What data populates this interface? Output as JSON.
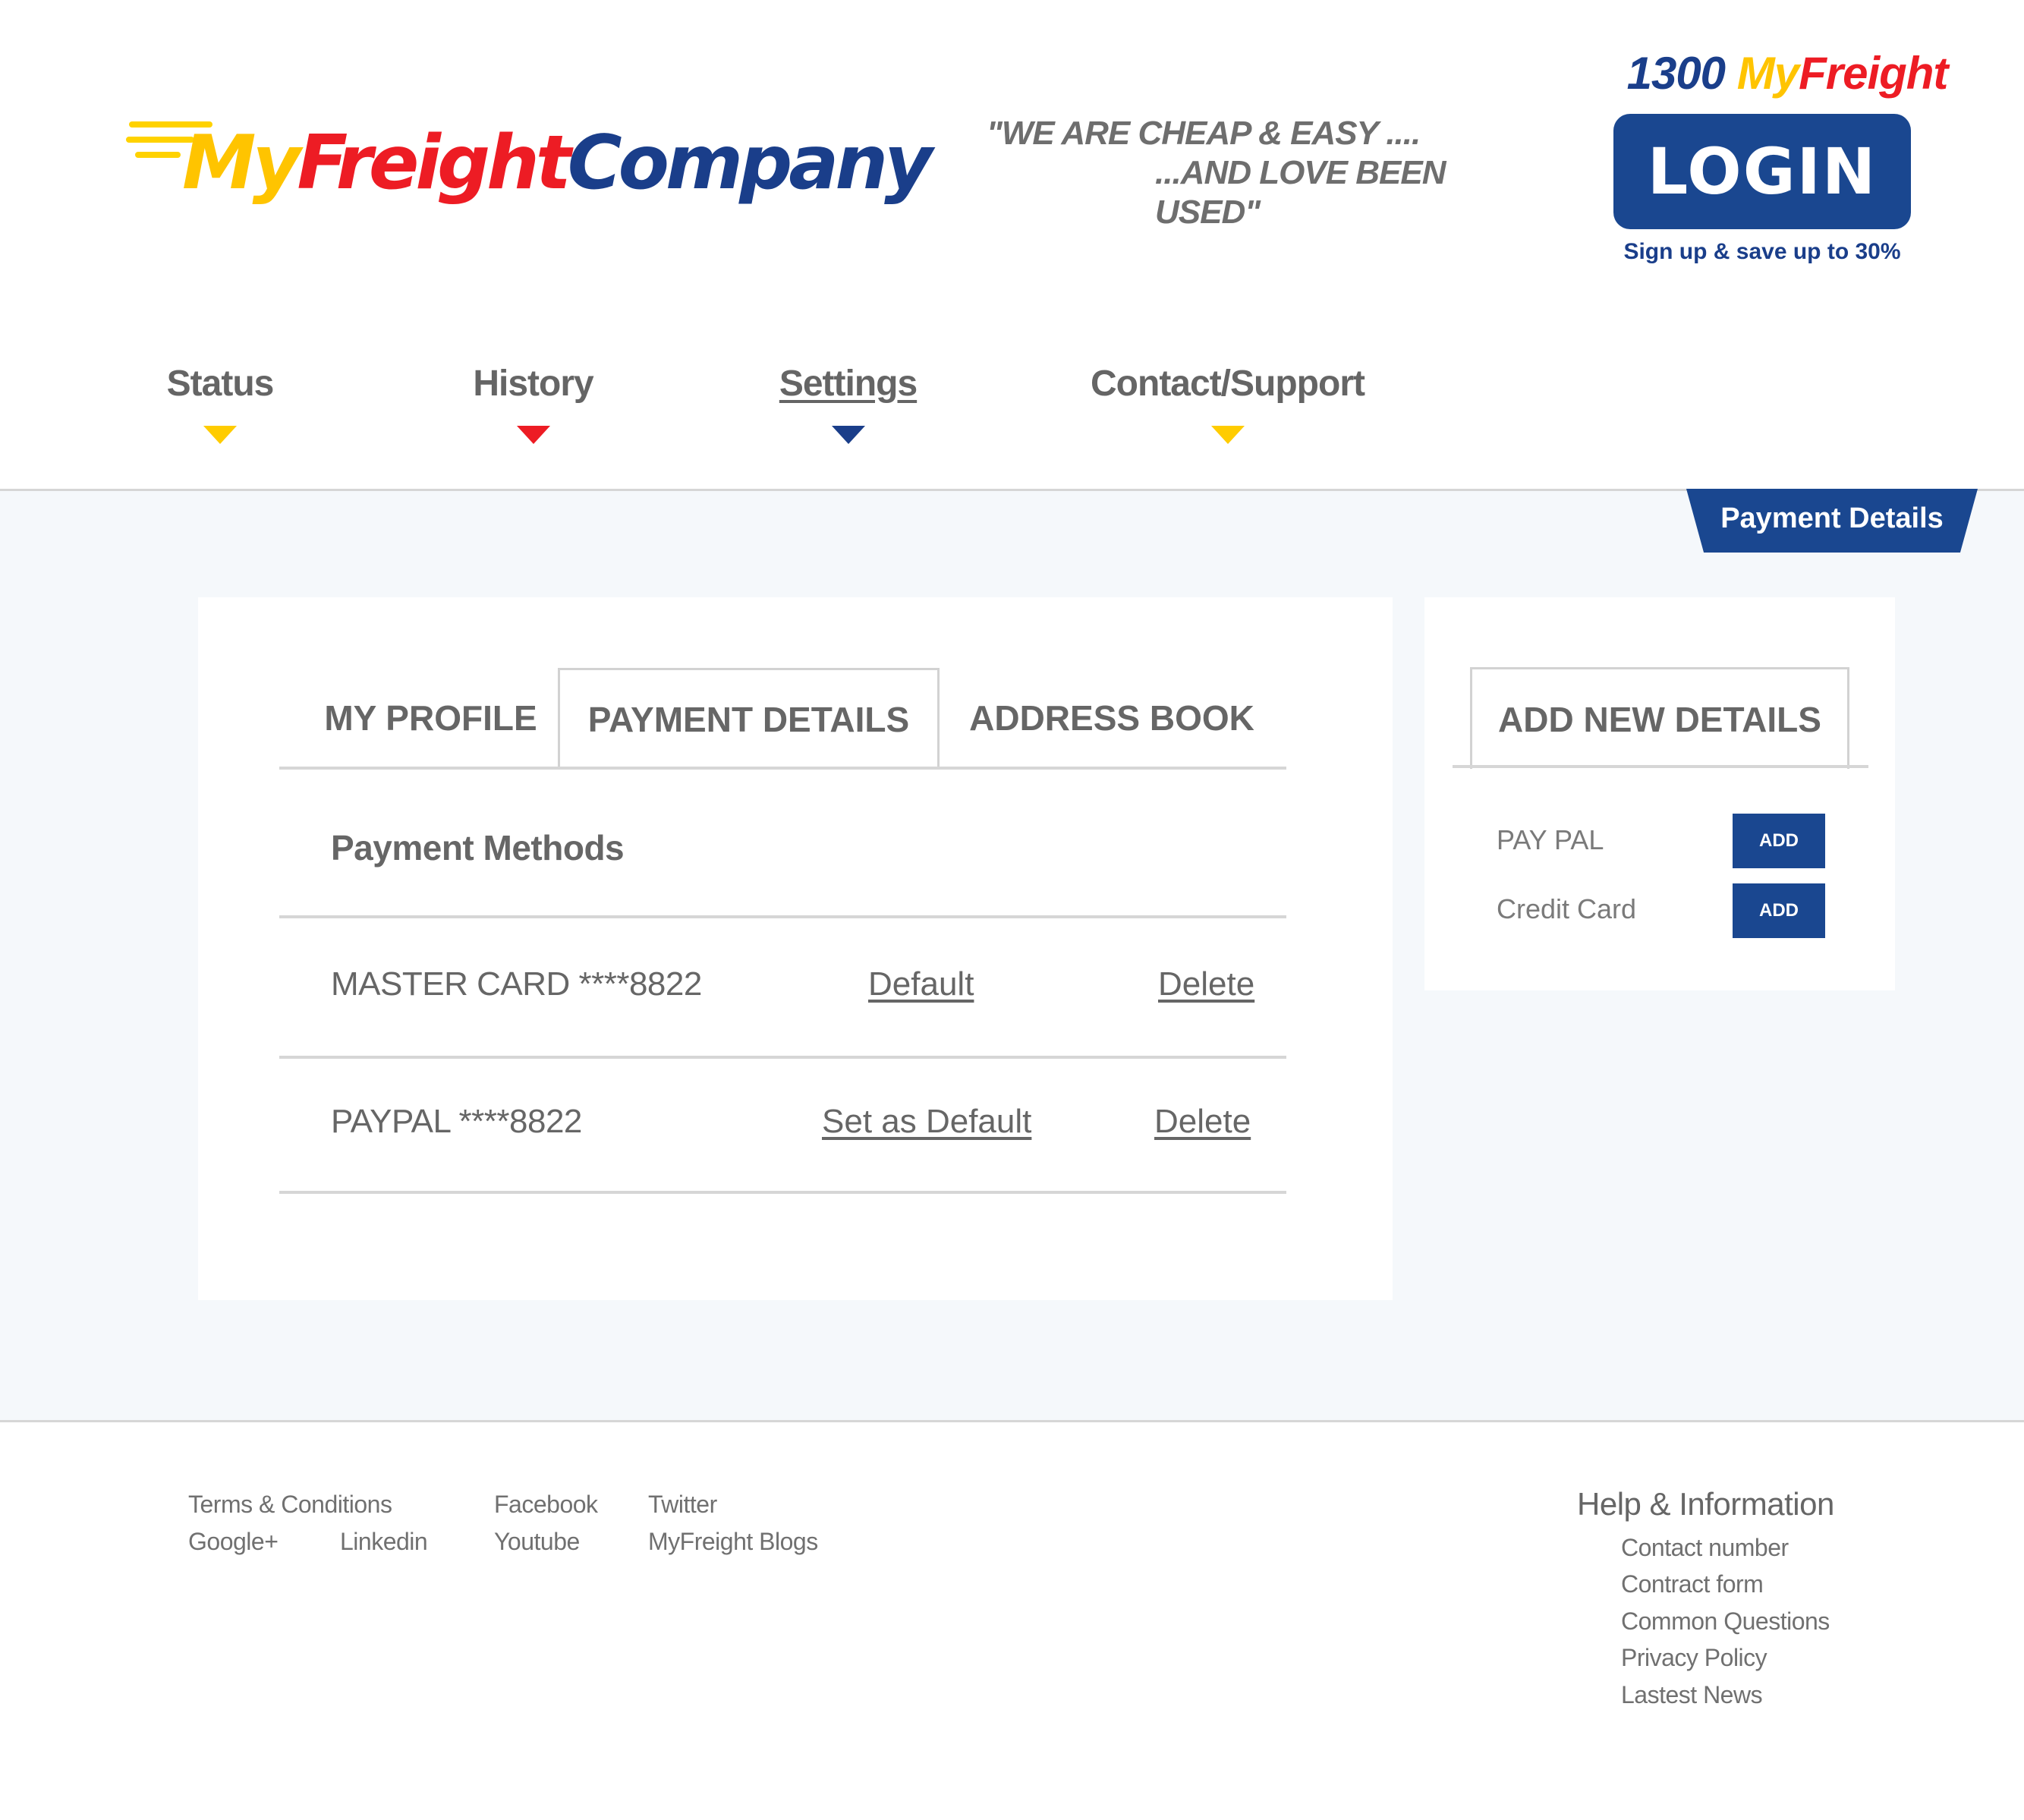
{
  "header": {
    "logo": {
      "my": "My",
      "freight": "Freight",
      "company": "Company"
    },
    "tagline": [
      "\"WE ARE CHEAP & EASY ....",
      "...AND LOVE BEEN USED\""
    ],
    "phone": {
      "number": "1300",
      "my": "My",
      "freight": "Freight"
    },
    "login_label": "LOGIN",
    "signup_text": "Sign up & save up to 30%"
  },
  "nav": {
    "items": [
      {
        "label": "Status",
        "arrow_color": "#ffcc00"
      },
      {
        "label": "History",
        "arrow_color": "#ed1c24"
      },
      {
        "label": "Settings",
        "arrow_color": "#1a3e8a",
        "active": true
      },
      {
        "label": "Contact/Support",
        "arrow_color": "#ffcc00"
      }
    ]
  },
  "breadcrumb": "Payment Details",
  "tabs": [
    {
      "label": "MY PROFILE"
    },
    {
      "label": "PAYMENT DETAILS",
      "active": true
    },
    {
      "label": "ADDRESS BOOK"
    }
  ],
  "payment": {
    "title": "Payment Methods",
    "methods": [
      {
        "name": "MASTER CARD ****8822",
        "action": "Default",
        "delete": "Delete"
      },
      {
        "name": "PAYPAL ****8822",
        "action": "Set as Default",
        "delete": "Delete"
      }
    ]
  },
  "side": {
    "title": "ADD NEW DETAILS",
    "options": [
      {
        "label": "PAY PAL",
        "button": "ADD"
      },
      {
        "label": "Credit Card",
        "button": "ADD"
      }
    ]
  },
  "footer": {
    "links": {
      "terms": "Terms & Conditions",
      "google": "Google+",
      "linkedin": "Linkedin",
      "facebook": "Facebook",
      "youtube": "Youtube",
      "twitter": "Twitter",
      "blogs": "MyFreight Blogs"
    },
    "help": {
      "title": "Help & Information",
      "items": [
        "Contact number",
        "Contract form",
        "Common Questions",
        "Privacy Policy",
        "Lastest News"
      ]
    }
  },
  "colors": {
    "brand_blue": "#1a4790",
    "brand_yellow": "#ffc400",
    "brand_red": "#ed1c24",
    "band": "#f5f8fb"
  }
}
